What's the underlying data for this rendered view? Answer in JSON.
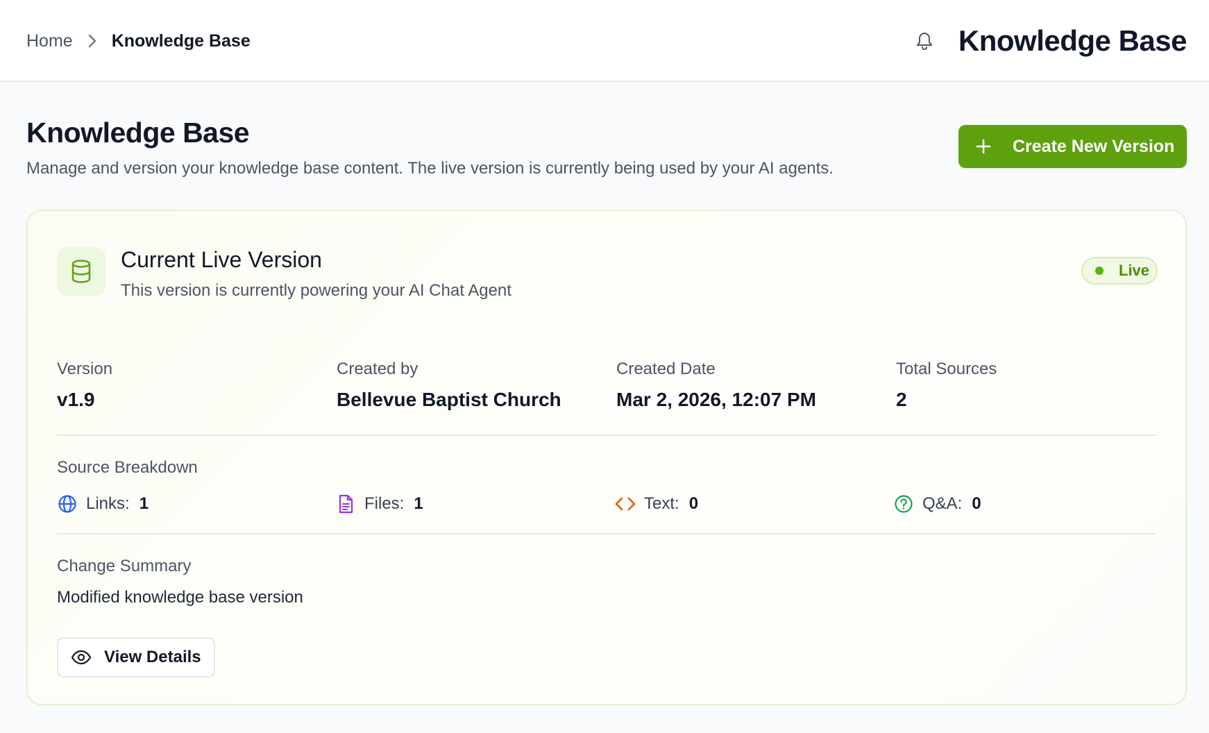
{
  "header": {
    "breadcrumb": {
      "home": "Home",
      "current": "Knowledge Base"
    },
    "title": "Knowledge Base",
    "icons": {
      "notifications": "bell-icon",
      "separator": "chevron-right-icon"
    }
  },
  "page": {
    "title": "Knowledge Base",
    "subtitle": "Manage and version your knowledge base content. The live version is currently being used by your AI agents.",
    "create_button": {
      "label": "Create New Version",
      "icon": "plus-icon"
    }
  },
  "live_card": {
    "icon": "database-icon",
    "title": "Current Live Version",
    "subtitle": "This version is currently powering your AI Chat Agent",
    "status_badge": "Live",
    "meta": [
      {
        "label": "Version",
        "value": "v1.9"
      },
      {
        "label": "Created by",
        "value": "Bellevue Baptist Church"
      },
      {
        "label": "Created Date",
        "value": "Mar 2, 2026, 12:07 PM"
      },
      {
        "label": "Total Sources",
        "value": "2"
      }
    ],
    "source_breakdown": {
      "label": "Source Breakdown",
      "items": [
        {
          "label": "Links:",
          "count": "1",
          "icon": "globe-icon"
        },
        {
          "label": "Files:",
          "count": "1",
          "icon": "file-text-icon"
        },
        {
          "label": "Text:",
          "count": "0",
          "icon": "code-icon"
        },
        {
          "label": "Q&A:",
          "count": "0",
          "icon": "help-circle-icon"
        }
      ]
    },
    "change_summary": {
      "label": "Change Summary",
      "text": "Modified knowledge base version"
    },
    "view_button": {
      "label": "View Details",
      "icon": "eye-icon"
    }
  },
  "colors": {
    "accent_green": "#5ea00e",
    "live_dot": "#58b40f",
    "links_icon": "#2563eb",
    "files_icon": "#9333ea",
    "text_icon": "#ea580c",
    "qa_icon": "#16a34a"
  }
}
